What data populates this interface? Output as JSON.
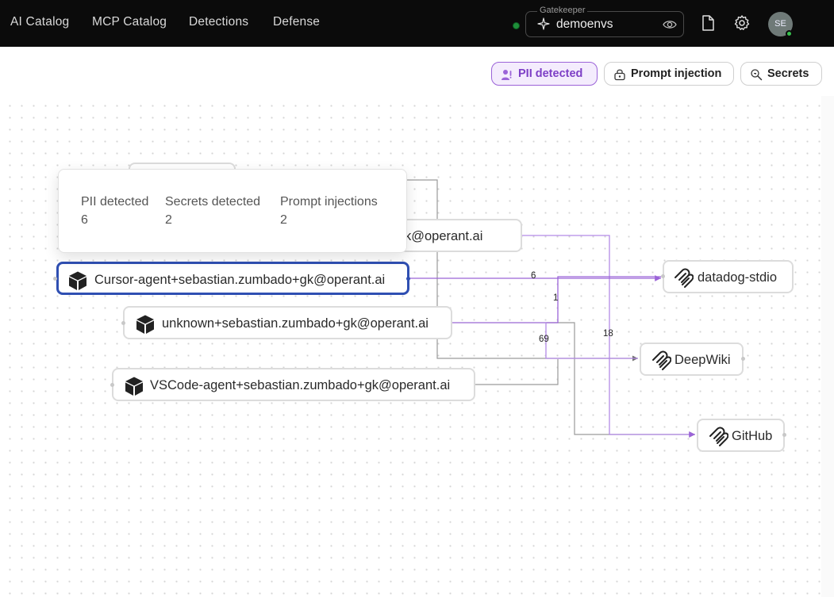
{
  "nav": {
    "items": [
      "AI Catalog",
      "MCP Catalog",
      "Detections",
      "Defense"
    ]
  },
  "gatekeeper": {
    "legend": "Gatekeeper",
    "value": "demoenvs",
    "status_color": "#1f8f3a"
  },
  "user": {
    "initials": "SE",
    "status_color": "#36c04d"
  },
  "filters": [
    {
      "label": "PII detected",
      "icon": "user-pii-icon",
      "active": true
    },
    {
      "label": "Prompt injection",
      "icon": "lock-injection-icon",
      "active": false
    },
    {
      "label": "Secrets",
      "icon": "search-key-icon",
      "active": false
    }
  ],
  "agents": [
    {
      "label": "o+gk@operant.ai",
      "icon": "package-icon"
    },
    {
      "label": "Cursor-agent+sebastian.zumbado+gk@operant.ai",
      "icon": "package-icon",
      "selected": true
    },
    {
      "label": "unknown+sebastian.zumbado+gk@operant.ai",
      "icon": "package-icon"
    },
    {
      "label": "VSCode-agent+sebastian.zumbado+gk@operant.ai",
      "icon": "package-icon"
    }
  ],
  "servers": [
    {
      "label": "datadog-stdio",
      "icon": "mcp-icon"
    },
    {
      "label": "DeepWiki",
      "icon": "mcp-icon"
    },
    {
      "label": "GitHub",
      "icon": "mcp-icon"
    }
  ],
  "edge_labels": [
    "6",
    "1",
    "69",
    "18"
  ],
  "tooltip": {
    "stats": [
      {
        "label": "PII detected",
        "value": "6"
      },
      {
        "label": "Secrets detected",
        "value": "2"
      },
      {
        "label": "Prompt injections",
        "value": "2"
      }
    ]
  },
  "colors": {
    "accent": "#9b63d8",
    "selected_border": "#2f4fb2",
    "edge_gray": "#8a8a8a"
  }
}
